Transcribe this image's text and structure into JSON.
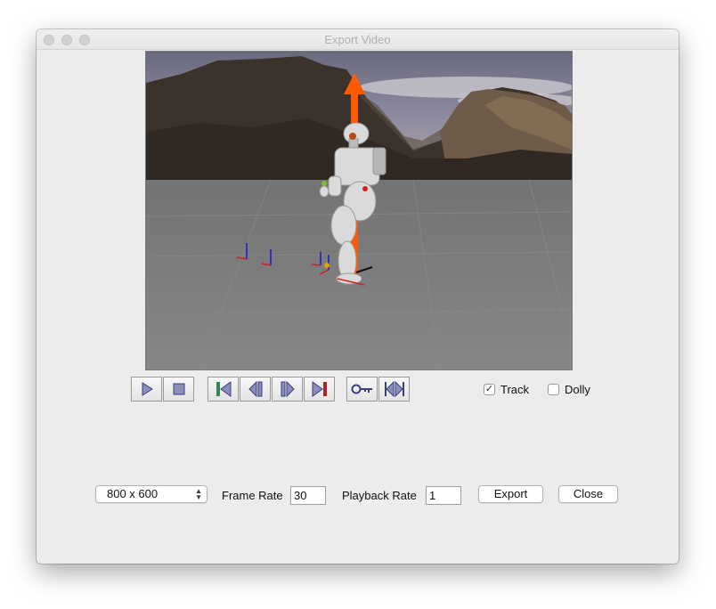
{
  "window": {
    "title": "Export Video"
  },
  "playback_controls": [
    {
      "name": "play-button",
      "icon": "play-icon"
    },
    {
      "name": "stop-button",
      "icon": "stop-icon"
    },
    {
      "name": "first-frame-button",
      "icon": "first-frame-icon"
    },
    {
      "name": "step-back-button",
      "icon": "step-back-icon"
    },
    {
      "name": "step-forward-button",
      "icon": "step-forward-icon"
    },
    {
      "name": "last-frame-button",
      "icon": "last-frame-icon"
    },
    {
      "name": "keyframe-button",
      "icon": "key-icon"
    },
    {
      "name": "range-button",
      "icon": "range-icon"
    }
  ],
  "options": {
    "track_label": "Track",
    "track_checked": true,
    "dolly_label": "Dolly",
    "dolly_checked": false
  },
  "export": {
    "resolution": "800 x 600",
    "frame_rate_label": "Frame Rate",
    "frame_rate_value": "30",
    "playback_rate_label": "Playback Rate",
    "playback_rate_value": "1",
    "export_label": "Export",
    "close_label": "Close"
  },
  "colors": {
    "axis_x": "#d11f1f",
    "axis_y": "#1a1acc",
    "axis_z": "#ff5a00",
    "ground": "#777777"
  }
}
